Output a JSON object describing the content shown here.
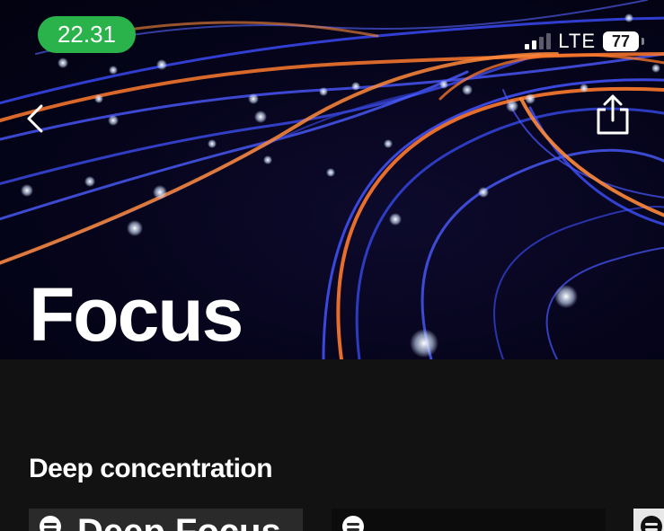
{
  "status_bar": {
    "time": "22.31",
    "network": "LTE",
    "battery": "77"
  },
  "header": {
    "back_icon": "chevron-left-icon",
    "share_icon": "share-icon"
  },
  "page": {
    "title": "Focus"
  },
  "sections": [
    {
      "title": "Deep concentration",
      "cards": [
        {
          "label": "Deep Focus",
          "icon": "spotify-icon"
        },
        {
          "label": "",
          "icon": "spotify-icon"
        },
        {
          "label": "",
          "icon": "spotify-icon"
        }
      ]
    }
  ],
  "colors": {
    "background": "#121212",
    "status_pill": "#2ab24b",
    "text": "#ffffff",
    "accent_orange": "#ff8a3a",
    "accent_blue": "#4a5cff"
  }
}
